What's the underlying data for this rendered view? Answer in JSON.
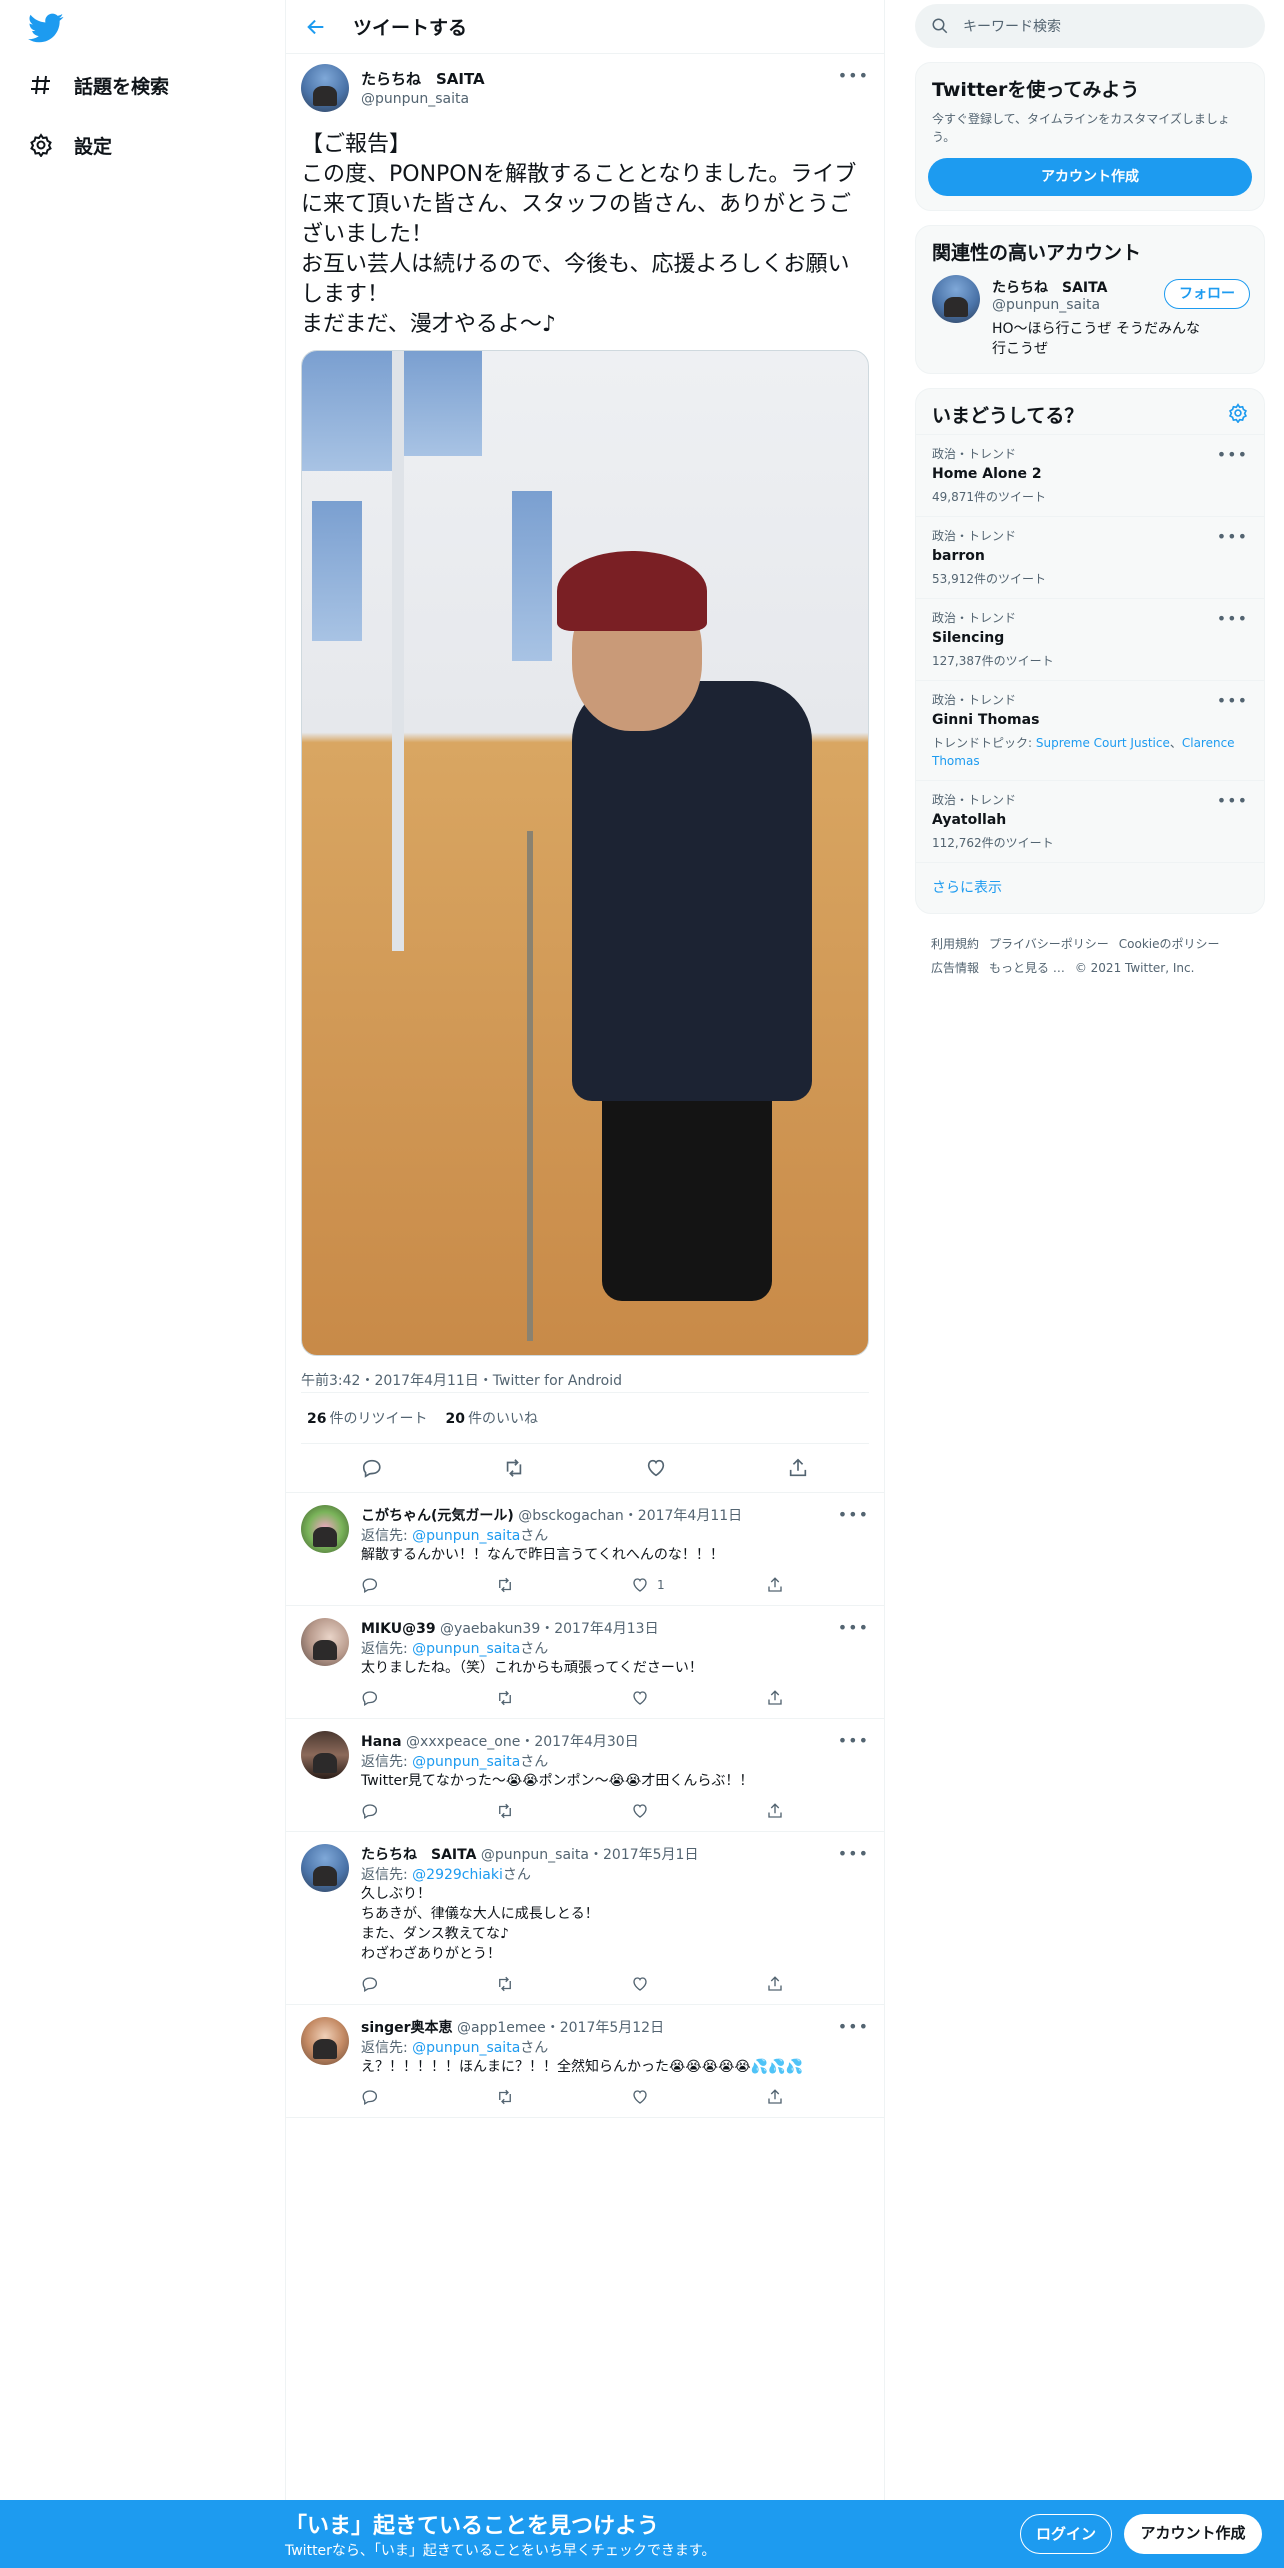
{
  "nav": {
    "explore_label": "話題を検索",
    "settings_label": "設定"
  },
  "header": {
    "title": "ツイートする"
  },
  "tweet": {
    "author_name": "たらちね　SAITA",
    "author_handle": "@punpun_saita",
    "text": "【ご報告】\nこの度、PONPONを解散することとなりました。ライブに来て頂いた皆さん、スタッフの皆さん、ありがとうございました！\nお互い芸人は続けるので、今後も、応援よろしくお願いします！\nまだまだ、漫才やるよ～♪",
    "meta": "午前3:42・2017年4月11日・Twitter for Android",
    "retweets_count": "26",
    "retweets_label": "件のリツイート",
    "likes_count": "20",
    "likes_label": "件のいいね"
  },
  "replies": [
    {
      "name": "こがちゃん(元気ガール)",
      "handle": "@bsckogachan",
      "date": "・2017年4月11日",
      "reply_to_prefix": "返信先: ",
      "reply_to": "@punpun_saita",
      "reply_to_suffix": "さん",
      "text": "解散するんかい！！なんで昨日言うてくれへんのな！！！",
      "likes": "1"
    },
    {
      "name": "MIKU@39",
      "handle": "@yaebakun39",
      "date": "・2017年4月13日",
      "reply_to_prefix": "返信先: ",
      "reply_to": "@punpun_saita",
      "reply_to_suffix": "さん",
      "text": "太りましたね。（笑）これからも頑張ってくださーい！",
      "likes": ""
    },
    {
      "name": "Hana",
      "handle": "@xxxpeace_one",
      "date": "・2017年4月30日",
      "reply_to_prefix": "返信先: ",
      "reply_to": "@punpun_saita",
      "reply_to_suffix": "さん",
      "text": "Twitter見てなかった〜😭😭ポンポン〜😭😭才田くんらぶ！！",
      "likes": ""
    },
    {
      "name": "たらちね　SAITA",
      "handle": "@punpun_saita",
      "date": "・2017年5月1日",
      "reply_to_prefix": "返信先: ",
      "reply_to": "@2929chiaki",
      "reply_to_suffix": "さん",
      "text": "久しぶり！\nちあきが、律儀な大人に成長しとる！\nまた、ダンス教えてな♪\nわざわざありがとう！",
      "likes": ""
    },
    {
      "name": "singer奥本恵",
      "handle": "@app1emee",
      "date": "・2017年5月12日",
      "reply_to_prefix": "返信先: ",
      "reply_to": "@punpun_saita",
      "reply_to_suffix": "さん",
      "text": "え？！！！！！ほんまに？！！全然知らんかった😭😭😭😭😭💦💦💦",
      "likes": ""
    }
  ],
  "search": {
    "placeholder": "キーワード検索"
  },
  "signup_card": {
    "title": "Twitterを使ってみよう",
    "subtitle": "今すぐ登録して、タイムラインをカスタマイズしましょう。",
    "button": "アカウント作成"
  },
  "related": {
    "title": "関連性の高いアカウント",
    "name": "たらちね　SAITA",
    "handle": "@punpun_saita",
    "bio": "HO～ほら行こうぜ そうだみんな行こうぜ",
    "follow": "フォロー"
  },
  "trends": {
    "title": "いまどうしてる？",
    "items": [
      {
        "category": "政治・トレンド",
        "name": "Home Alone 2",
        "count": "49,871件のツイート"
      },
      {
        "category": "政治・トレンド",
        "name": "barron",
        "count": "53,912件のツイート"
      },
      {
        "category": "政治・トレンド",
        "name": "Silencing",
        "count": "127,387件のツイート"
      },
      {
        "category": "政治・トレンド",
        "name": "Ginni Thomas",
        "count_prefix": "トレンドトピック: ",
        "topic1": "Supreme Court Justice",
        "topic_sep": "、",
        "topic2": "Clarence Thomas"
      },
      {
        "category": "政治・トレンド",
        "name": "Ayatollah",
        "count": "112,762件のツイート"
      }
    ],
    "show_more": "さらに表示"
  },
  "footer": {
    "terms": "利用規約",
    "privacy": "プライバシーポリシー",
    "cookie": "Cookieのポリシー",
    "ads": "広告情報",
    "more": "もっと見る …",
    "copyright": "© 2021 Twitter, Inc."
  },
  "bottom_bar": {
    "headline": "「いま」起きていることを見つけよう",
    "subline": "Twitterなら、「いま」起きていることをいち早くチェックできます。",
    "login": "ログイン",
    "signup": "アカウント作成"
  },
  "colors": {
    "accent": "#1d9bf0",
    "text": "#0f1419",
    "muted": "#536471"
  }
}
